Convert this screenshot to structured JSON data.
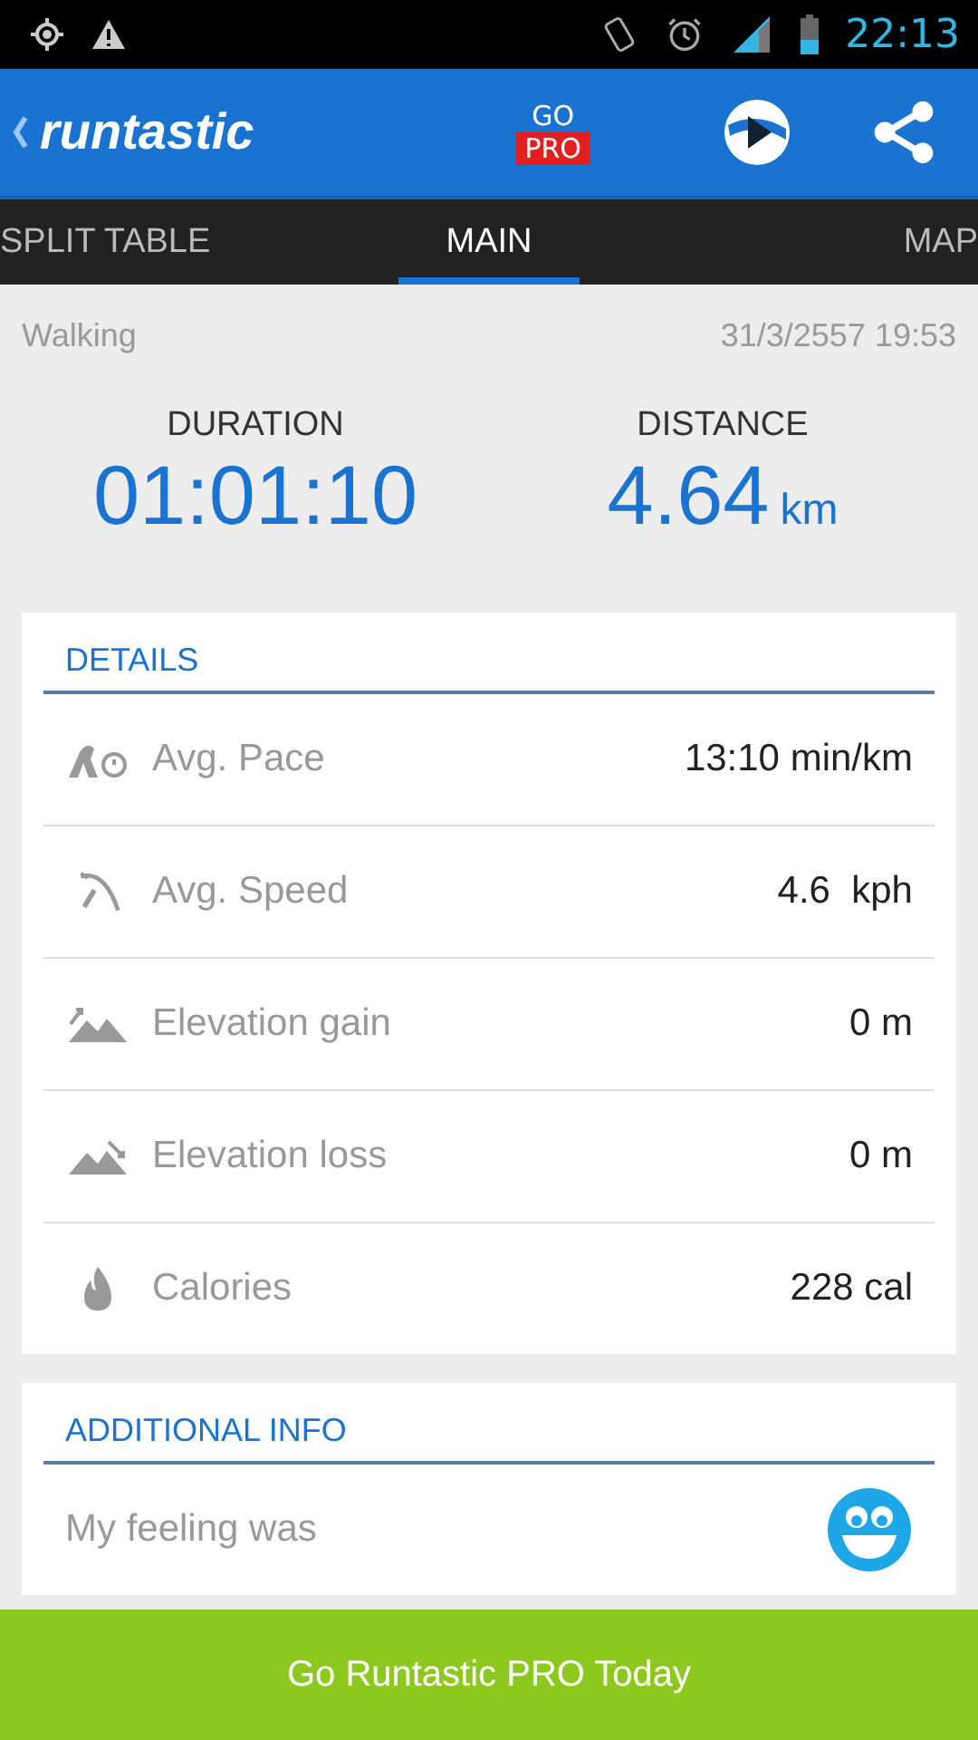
{
  "status_bar": {
    "time": "22:13"
  },
  "app_bar": {
    "logo": "runtastic",
    "go_pro": {
      "top": "GO",
      "badge": "PRO"
    }
  },
  "tabs": [
    {
      "label": "SPLIT TABLE",
      "selected": false
    },
    {
      "label": "MAIN",
      "selected": true
    },
    {
      "label": "MAP",
      "selected": false
    }
  ],
  "activity": {
    "type": "Walking",
    "date": "31/3/2557 19:53"
  },
  "summary": [
    {
      "label": "DURATION",
      "value": "01:01:10"
    },
    {
      "label": "DISTANCE",
      "value": "4.64",
      "unit": "km"
    }
  ],
  "details": {
    "title": "DETAILS",
    "rows": [
      {
        "kind": "pace",
        "label": "Avg. Pace",
        "value": "13:10 min/km"
      },
      {
        "kind": "speed",
        "label": "Avg. Speed",
        "value": "4.6  kph"
      },
      {
        "kind": "gain",
        "label": "Elevation gain",
        "value": "0 m"
      },
      {
        "kind": "loss",
        "label": "Elevation loss",
        "value": "0 m"
      },
      {
        "kind": "calories",
        "label": "Calories",
        "value": "228 cal"
      }
    ]
  },
  "additional_info": {
    "title": "ADDITIONAL INFO",
    "feeling_label": "My feeling was"
  },
  "promo_button": "Go Runtastic PRO Today"
}
